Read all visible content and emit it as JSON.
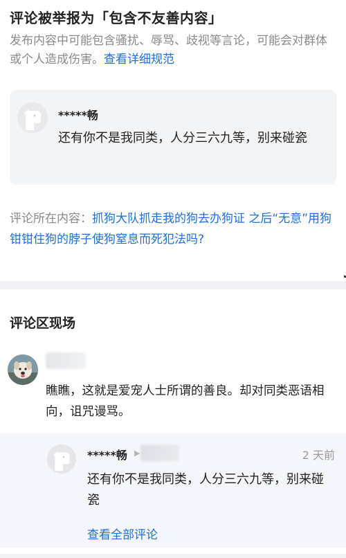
{
  "header": {
    "title": "评论被举报为「包含不友善内容」",
    "description": "发布内容中可能包含骚扰、辱骂、歧视等言论，可能会对群体或个人造成伤害。",
    "details_link": "查看详细规范"
  },
  "reported_comment": {
    "author": "*****畅",
    "text": "还有你不是我同类，人分三六九等，别来碰瓷"
  },
  "context": {
    "label": "评论所在内容：",
    "post_title": "抓狗大队抓走我的狗去办狗证 之后“无意”用狗钳钳住狗的脖子使狗窒息而死犯法吗?"
  },
  "comment_scene": {
    "title": "评论区现场",
    "parent_comment": {
      "text": "瞧瞧，这就是爱宠人士所谓的善良。却对同类恶语相向，诅咒谩骂。"
    },
    "reply": {
      "author": "*****畅",
      "time": "2 天前",
      "text": "还有你不是我同类，人分三六九等，别来碰瓷"
    },
    "view_all_label": "查看全部评论"
  },
  "icons": {
    "default_avatar": "dog-avatar-icon",
    "commenter_avatar": "dog-photo-avatar",
    "reply_arrow": "reply-arrow-icon"
  },
  "colors": {
    "link": "#1e6fd9",
    "muted": "#8a8a8a",
    "card_bg": "#f3f4f6"
  }
}
